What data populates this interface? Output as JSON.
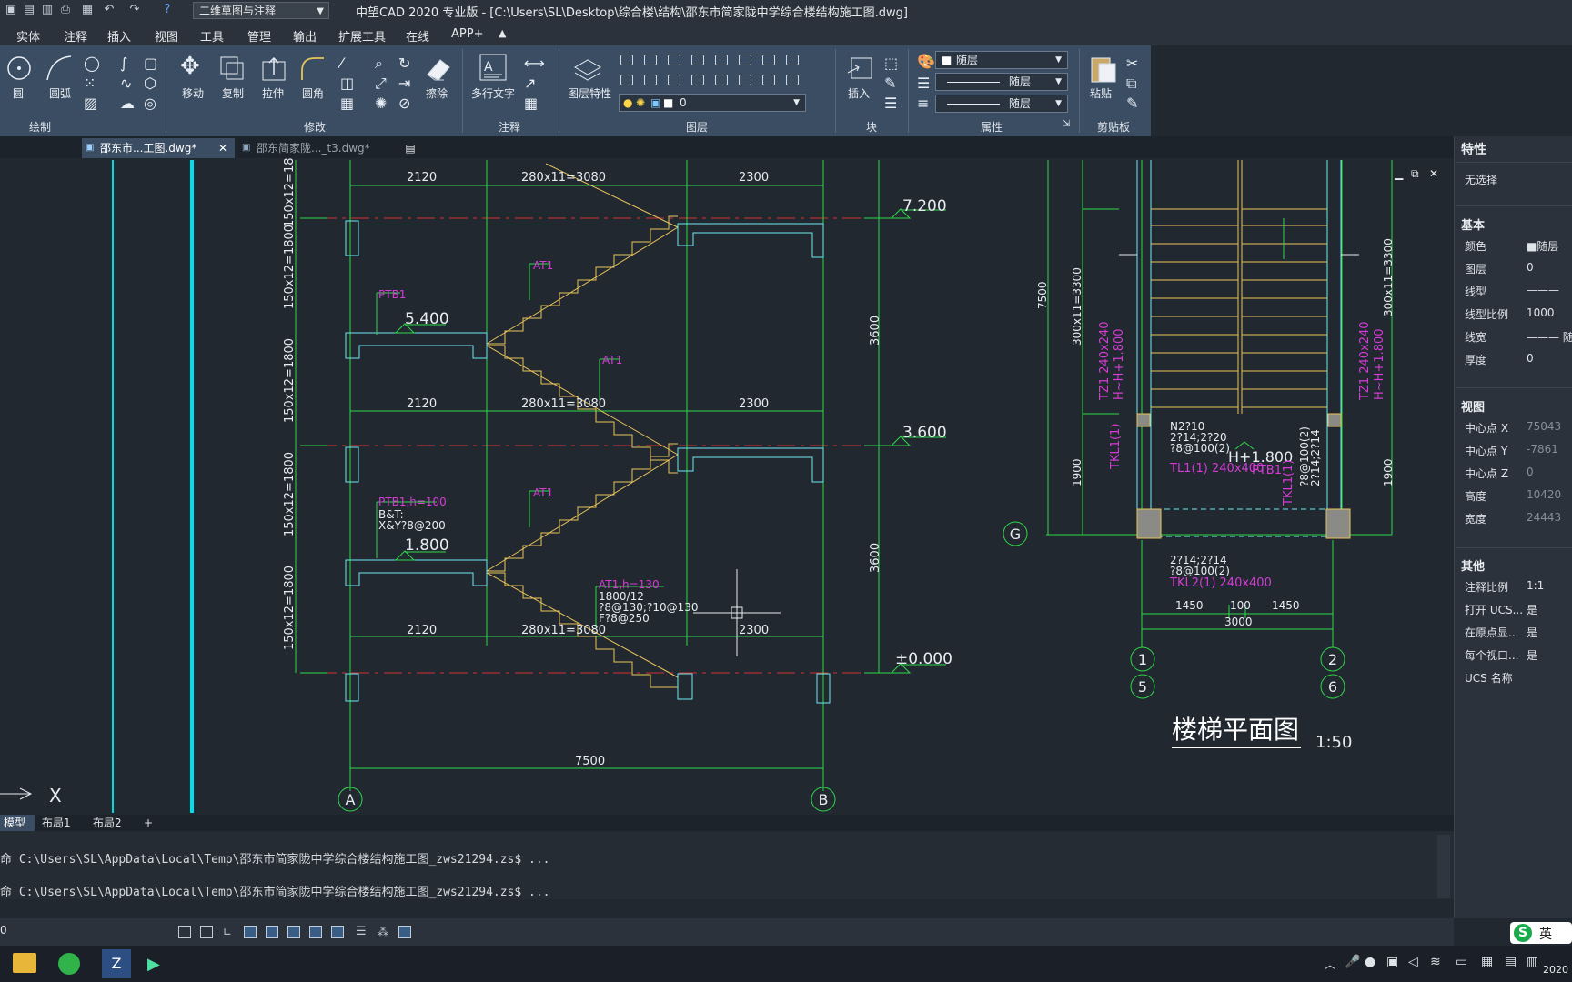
{
  "titlebar": {
    "workspace": "二维草图与注释",
    "title": "中望CAD 2020 专业版 - [C:\\Users\\SL\\Desktop\\综合楼\\结构\\邵东市简家陇中学综合楼结构施工图.dwg]"
  },
  "menu": [
    "实体",
    "注释",
    "插入",
    "视图",
    "工具",
    "管理",
    "输出",
    "扩展工具",
    "在线",
    "APP+"
  ],
  "ribbon": {
    "draw": {
      "circle": "圆",
      "arc": "圆弧",
      "panel": "绘制"
    },
    "modify": {
      "move": "移动",
      "copy": "复制",
      "stretch": "拉伸",
      "fillet": "圆角",
      "erase": "擦除",
      "panel": "修改"
    },
    "annotate": {
      "mtext": "多行文字",
      "panel": "注释"
    },
    "layer": {
      "props": "图层特性",
      "current": "0",
      "panel": "图层"
    },
    "block": {
      "insert": "插入",
      "panel": "块"
    },
    "properties": {
      "color": "随层",
      "linetype": "随层",
      "lineweight": "随层",
      "panel": "属性"
    },
    "clipboard": {
      "paste": "粘贴",
      "panel": "剪贴板"
    }
  },
  "tabs": [
    {
      "label": "邵东市...工图.dwg*",
      "active": true
    },
    {
      "label": "邵东简家陇..._t3.dwg*",
      "active": false
    }
  ],
  "drawing": {
    "dim_2120": "2120",
    "dim_280x11": "280x11=3080",
    "dim_2300": "2300",
    "dim_3600": "3600",
    "dim_7500": "7500",
    "dim_150x12": "150x12=1800",
    "el_7200": "7.200",
    "el_5400": "5.400",
    "el_3600": "3.600",
    "el_1800": "1.800",
    "el_0000": "±0.000",
    "at1": "AT1",
    "ptb1": "PTB1",
    "ptb1h": "PTB1,h=100",
    "bt": "B&T:",
    "xy": "X&Y?8@200",
    "at1h": "AT1,h=130",
    "at1_l1": "1800/12",
    "at1_l2": "?8@130;?10@130",
    "at1_l3": "F?8@250",
    "axis_a": "A",
    "axis_b": "B",
    "axis_g": "G",
    "axis_1": "1",
    "axis_2": "2",
    "axis_5": "5",
    "axis_6": "6",
    "plan_title": "楼梯平面图",
    "plan_scale": "1:50",
    "plan_7500": "7500",
    "plan_300x11": "300x11=3300",
    "plan_1900": "1900",
    "plan_tz1": "TZ1 240x240",
    "plan_tz1h": "H~H+1.800",
    "plan_h1800": "H+1.800",
    "plan_tl1": "TL1(1) 240x400",
    "plan_ptb1": "PTB1",
    "plan_n2210": "N2?10",
    "plan_2214": "2?14;2?20",
    "plan_8100": "?8@100(2)",
    "plan_tkl1": "TKL1(1)",
    "plan_2214b": "2?14;2?14",
    "plan_8100b": "?8@100(2)",
    "plan_tkl2": "TKL2(1) 240x400",
    "plan_1450a": "1450",
    "plan_100": "100",
    "plan_1450b": "1450",
    "plan_3000": "3000",
    "ucs_x": "X"
  },
  "layouts": [
    "模型",
    "布局1",
    "布局2",
    "+"
  ],
  "command": {
    "line1": "命 C:\\Users\\SL\\AppData\\Local\\Temp\\邵东市简家陇中学综合楼结构施工图_zws21294.zs$ ...",
    "line2": "命 C:\\Users\\SL\\AppData\\Local\\Temp\\邵东市简家陇中学综合楼结构施工图_zws21294.zs$ ..."
  },
  "status": {
    "coord": "0"
  },
  "props": {
    "title": "特性",
    "selection": "无选择",
    "basic": "基本",
    "rows": [
      {
        "k": "颜色",
        "v": "■随层"
      },
      {
        "k": "图层",
        "v": "0"
      },
      {
        "k": "线型",
        "v": "———"
      },
      {
        "k": "线型比例",
        "v": "1000"
      },
      {
        "k": "线宽",
        "v": "——— 随"
      },
      {
        "k": "厚度",
        "v": "0"
      }
    ],
    "view": "视图",
    "view_rows": [
      {
        "k": "中心点 X",
        "v": "75043"
      },
      {
        "k": "中心点 Y",
        "v": "-7861"
      },
      {
        "k": "中心点 Z",
        "v": "0"
      },
      {
        "k": "高度",
        "v": "10420"
      },
      {
        "k": "宽度",
        "v": "24443"
      }
    ],
    "other": "其他",
    "other_rows": [
      {
        "k": "注释比例",
        "v": "1:1"
      },
      {
        "k": "打开 UCS...",
        "v": "是"
      },
      {
        "k": "在原点显...",
        "v": "是"
      },
      {
        "k": "每个视口...",
        "v": "是"
      },
      {
        "k": "UCS 名称",
        "v": ""
      }
    ]
  },
  "taskbar": {
    "ime": "英",
    "year": "2020"
  }
}
